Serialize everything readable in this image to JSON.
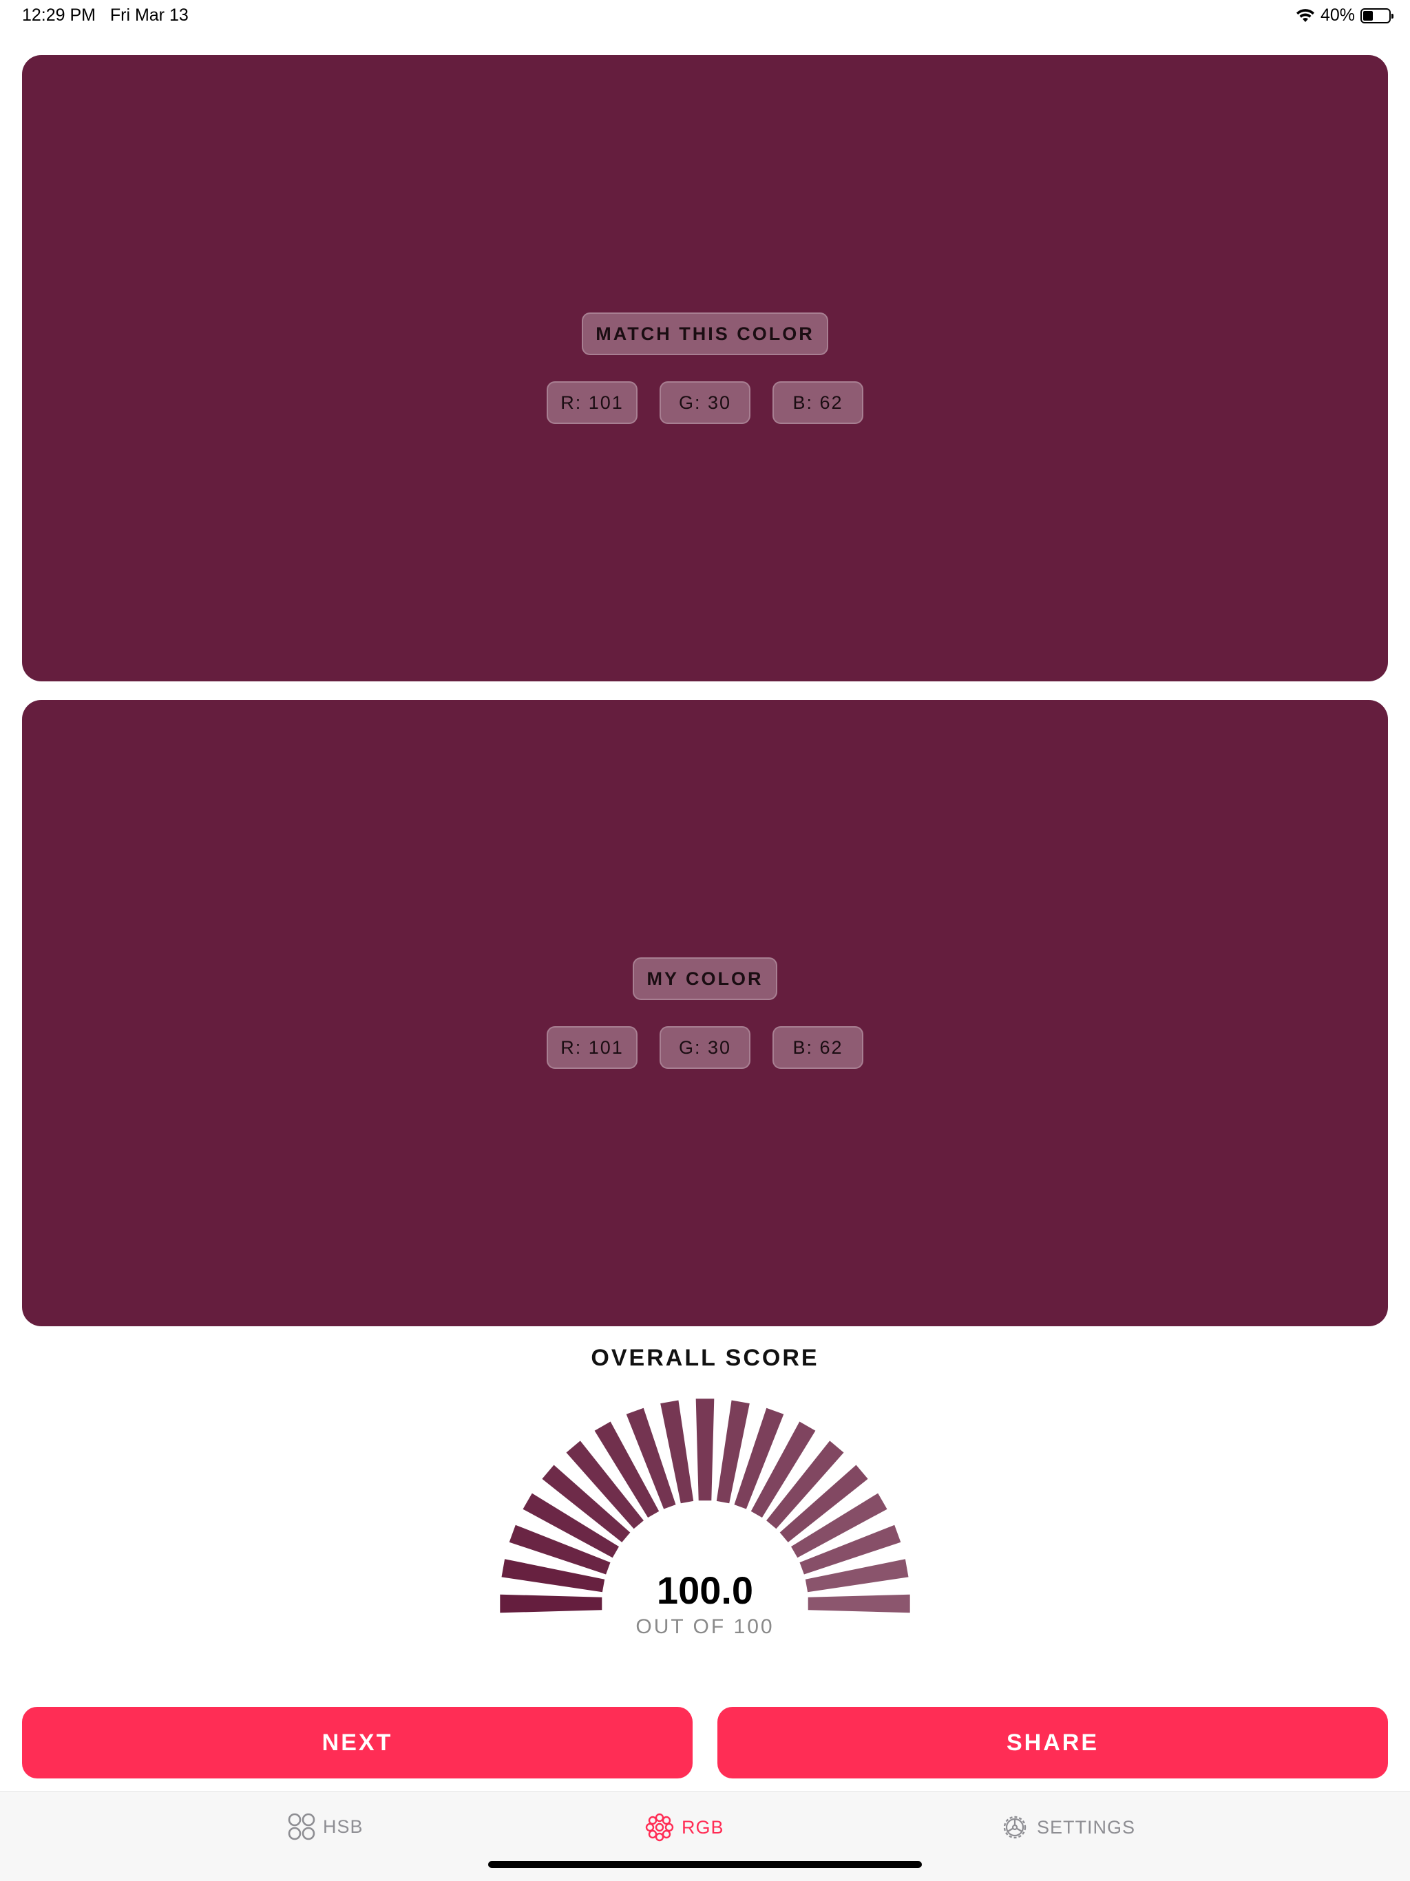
{
  "status_bar": {
    "time": "12:29 PM",
    "date": "Fri Mar 13",
    "battery": "40%",
    "battery_level": 0.4
  },
  "colors": {
    "target": "#651E3E",
    "mine": "#651E3E",
    "accent": "#FF2D55"
  },
  "target_panel": {
    "title": "MATCH THIS COLOR",
    "r": "R: 101",
    "g": "G: 30",
    "b": "B: 62"
  },
  "my_panel": {
    "title": "MY COLOR",
    "r": "R: 101",
    "g": "G: 30",
    "b": "B: 62"
  },
  "score": {
    "title": "OVERALL SCORE",
    "value": "100.0",
    "subtitle": "OUT OF 100",
    "fraction": 1.0
  },
  "actions": {
    "next": "NEXT",
    "share": "SHARE"
  },
  "tabs": [
    {
      "label": "HSB",
      "icon": "four-circles-icon",
      "selected": false
    },
    {
      "label": "RGB",
      "icon": "color-flower-icon",
      "selected": true
    },
    {
      "label": "SETTINGS",
      "icon": "gear-icon",
      "selected": false
    }
  ]
}
